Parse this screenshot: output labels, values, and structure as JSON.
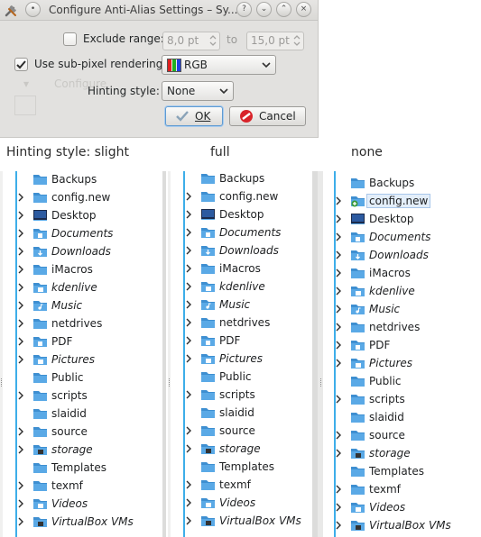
{
  "dialog": {
    "title": "Configure Anti-Alias Settings – Sy...",
    "title_buttons": [
      "?",
      "⌄",
      "⌃",
      "×"
    ],
    "exclude_label": "Exclude range:",
    "exclude_checked": false,
    "range_from": "8,0 pt",
    "range_to_word": "to",
    "range_to": "15,0 pt",
    "subpixel_label": "Use sub-pixel rendering:",
    "subpixel_checked": true,
    "subpixel_value": "RGB",
    "hinting_label": "Hinting style:",
    "hinting_value": "None",
    "ok_label": "OK",
    "cancel_label": "Cancel",
    "background_ghost": "Configure"
  },
  "captions": {
    "slight": "Hinting style: slight",
    "full": "full",
    "none": "none"
  },
  "folders": [
    {
      "name": "Backups",
      "italic": false,
      "expander": false,
      "icon": "folder-icon"
    },
    {
      "name": "config.new",
      "italic": false,
      "expander": true,
      "icon": "folder-icon"
    },
    {
      "name": "Desktop",
      "italic": false,
      "expander": true,
      "icon": "desktop-folder-icon"
    },
    {
      "name": "Documents",
      "italic": true,
      "expander": true,
      "icon": "documents-folder-icon"
    },
    {
      "name": "Downloads",
      "italic": true,
      "expander": true,
      "icon": "downloads-folder-icon"
    },
    {
      "name": "iMacros",
      "italic": false,
      "expander": true,
      "icon": "folder-icon"
    },
    {
      "name": "kdenlive",
      "italic": true,
      "expander": true,
      "icon": "kdenlive-folder-icon"
    },
    {
      "name": "Music",
      "italic": true,
      "expander": true,
      "icon": "music-folder-icon"
    },
    {
      "name": "netdrives",
      "italic": false,
      "expander": true,
      "icon": "folder-icon"
    },
    {
      "name": "PDF",
      "italic": false,
      "expander": true,
      "icon": "pdf-folder-icon"
    },
    {
      "name": "Pictures",
      "italic": true,
      "expander": true,
      "icon": "pictures-folder-icon"
    },
    {
      "name": "Public",
      "italic": false,
      "expander": false,
      "icon": "folder-icon"
    },
    {
      "name": "scripts",
      "italic": false,
      "expander": true,
      "icon": "folder-icon"
    },
    {
      "name": "slaidid",
      "italic": false,
      "expander": false,
      "icon": "folder-icon"
    },
    {
      "name": "source",
      "italic": false,
      "expander": true,
      "icon": "folder-icon"
    },
    {
      "name": "storage",
      "italic": true,
      "expander": true,
      "icon": "storage-folder-icon"
    },
    {
      "name": "Templates",
      "italic": false,
      "expander": false,
      "icon": "folder-icon"
    },
    {
      "name": "texmf",
      "italic": false,
      "expander": true,
      "icon": "folder-icon"
    },
    {
      "name": "Videos",
      "italic": true,
      "expander": true,
      "icon": "videos-folder-icon"
    },
    {
      "name": "VirtualBox VMs",
      "italic": true,
      "expander": true,
      "icon": "virtualbox-folder-icon"
    }
  ],
  "colors": {
    "accent": "#3daee9",
    "folder_blue": "#3e8fd1",
    "selection_bg": "#e3eefa"
  }
}
